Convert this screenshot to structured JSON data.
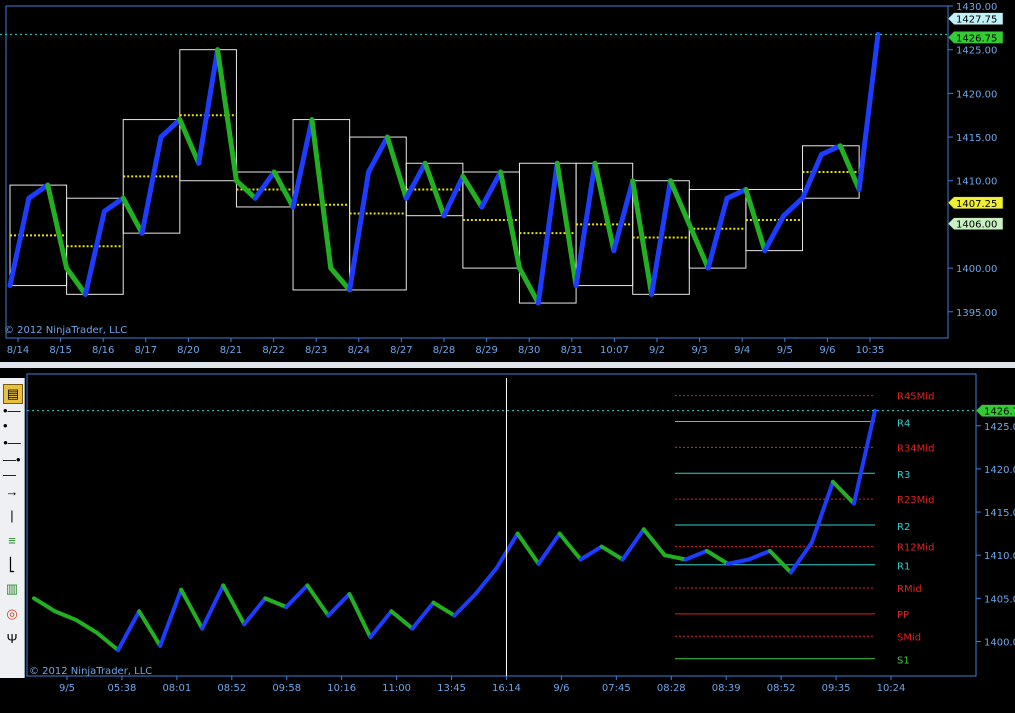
{
  "colors": {
    "background": "#000000",
    "axis": "#3f7fd6",
    "axis_text": "#6fa6e8",
    "up_bar": "#1e3cff",
    "down_bar": "#22b022",
    "doji_bar": "#ffff40",
    "box": "#e8e8e8",
    "box_low": "#b6f07a",
    "midline": "#e8e000",
    "price_line": "#2fd3c8",
    "pivot_red": "#e02020",
    "pivot_cyan": "#30d0d0",
    "pivot_green": "#40d040",
    "separator": "#dfe3ea"
  },
  "top": {
    "copyright": "© 2012 NinjaTrader, LLC",
    "price_tags": [
      {
        "text": "1427.75",
        "value": 1427.75,
        "bg": "#c0f0f8"
      },
      {
        "text": "1426.75",
        "value": 1426.75,
        "bg": "#33cc33"
      },
      {
        "text": "1407.25",
        "value": 1407.25,
        "bg": "#f0f030"
      },
      {
        "text": "1406.00",
        "value": 1406.0,
        "bg": "#c8f0c0"
      }
    ],
    "x_labels": [
      "8/14",
      "8/15",
      "8/16",
      "8/17",
      "8/20",
      "8/21",
      "8/22",
      "8/23",
      "8/24",
      "8/27",
      "8/28",
      "8/29",
      "8/30",
      "8/31",
      "10:07",
      "9/2",
      "9/3",
      "9/4",
      "9/5",
      "9/6",
      "10:35"
    ]
  },
  "bottom": {
    "copyright": "© 2012 NinjaTrader, LLC",
    "price_tag": {
      "text": "1426.75",
      "value": 1426.75
    },
    "x_labels": [
      "9/5",
      "05:38",
      "08:01",
      "08:52",
      "09:58",
      "10:16",
      "11:00",
      "13:45",
      "16:14",
      "9/6",
      "07:45",
      "08:28",
      "08:39",
      "08:52",
      "09:35",
      "10:24"
    ],
    "pivots": [
      {
        "label": "R45Mid",
        "value": 1428.5,
        "kind": "mid"
      },
      {
        "label": "R4",
        "value": 1425.5,
        "kind": "r"
      },
      {
        "label": "R34Mid",
        "value": 1422.5,
        "kind": "mid"
      },
      {
        "label": "R3",
        "value": 1419.5,
        "kind": "r"
      },
      {
        "label": "R23Mid",
        "value": 1416.5,
        "kind": "mid"
      },
      {
        "label": "R2",
        "value": 1413.5,
        "kind": "r"
      },
      {
        "label": "R12Mid",
        "value": 1411.0,
        "kind": "mid"
      },
      {
        "label": "R1",
        "value": 1408.9,
        "kind": "r"
      },
      {
        "label": "RMid",
        "value": 1406.2,
        "kind": "mid"
      },
      {
        "label": "PP",
        "value": 1403.2,
        "kind": "pp"
      },
      {
        "label": "SMid",
        "value": 1400.6,
        "kind": "mid"
      },
      {
        "label": "S1",
        "value": 1398.0,
        "kind": "s"
      }
    ]
  },
  "toolbar": {
    "tools": [
      "ruler-icon",
      "line-icon",
      "ray-icon",
      "extended-line-icon",
      "arrow-icon",
      "vertical-line-icon",
      "horizontal-lines-icon",
      "fibonacci-icon",
      "bars-icon",
      "circle-icon",
      "andrews-pitchfork-icon"
    ]
  },
  "chart_data": [
    {
      "type": "line",
      "title": "",
      "xlabel": "",
      "ylabel": "",
      "ylim": [
        1392,
        1430
      ],
      "y_ticks": [
        1395,
        1400,
        1405,
        1410,
        1415,
        1420,
        1425,
        1430
      ],
      "grid": false,
      "series": [
        {
          "values": [
            1398,
            1408,
            1409.5,
            1400,
            1397,
            1406.5,
            1408,
            1404,
            1415,
            1417,
            1412,
            1425,
            1410,
            1408,
            1411,
            1407,
            1417,
            1400,
            1397.5,
            1411,
            1415,
            1408,
            1412,
            1406,
            1410.5,
            1407,
            1411,
            1400,
            1396,
            1412,
            1398,
            1412,
            1402,
            1410,
            1397,
            1410,
            1405,
            1400,
            1408,
            1409,
            1402,
            1406,
            1408,
            1413,
            1414,
            1409,
            1426.75
          ]
        }
      ],
      "horizontal_line": 1426.75
    },
    {
      "type": "line",
      "title": "",
      "xlabel": "",
      "ylabel": "",
      "ylim": [
        1396,
        1431
      ],
      "y_ticks": [
        1400,
        1405,
        1410,
        1415,
        1420,
        1425
      ],
      "grid": false,
      "series": [
        {
          "values": [
            1405,
            1403.5,
            1402.5,
            1401,
            1399,
            1403.5,
            1399.5,
            1406,
            1401.5,
            1406.5,
            1402,
            1405,
            1404,
            1406.5,
            1403,
            1405.5,
            1400.5,
            1403.5,
            1401.5,
            1404.5,
            1403,
            1405.5,
            1408.5,
            1412.5,
            1409,
            1412.5,
            1409.5,
            1411,
            1409.5,
            1413,
            1410,
            1409.5,
            1410.5,
            1409,
            1409.5,
            1410.5,
            1408,
            1411.5,
            1418.5,
            1416,
            1426.75
          ]
        }
      ],
      "vertical_marker_label": "16:14",
      "horizontal_line": 1426.75
    }
  ]
}
